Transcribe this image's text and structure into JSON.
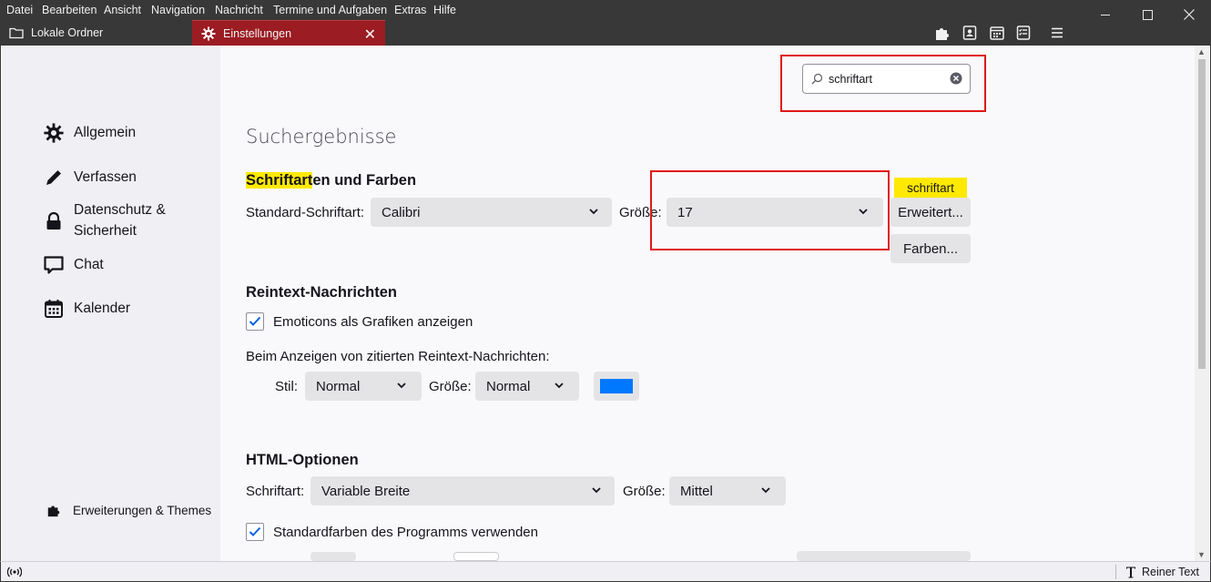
{
  "menubar": {
    "items": [
      "Datei",
      "Bearbeiten",
      "Ansicht",
      "Navigation",
      "Nachricht",
      "Termine und Aufgaben",
      "Extras",
      "Hilfe"
    ]
  },
  "tabs": [
    {
      "label": "Lokale Ordner",
      "icon": "folder-icon",
      "active": false
    },
    {
      "label": "Einstellungen",
      "icon": "gear-icon",
      "active": true
    }
  ],
  "toolbar_icons": [
    "addons-icon",
    "address-book-icon",
    "calendar-icon",
    "tasks-icon",
    "menu-icon"
  ],
  "sidebar": {
    "categories": [
      {
        "label": "Allgemein",
        "icon": "gear-icon"
      },
      {
        "label": "Verfassen",
        "icon": "pencil-icon"
      },
      {
        "label": "Datenschutz &\nSicherheit",
        "icon": "lock-icon"
      },
      {
        "label": "Chat",
        "icon": "chat-icon"
      },
      {
        "label": "Kalender",
        "icon": "calendar-icon"
      }
    ],
    "extensions_label": "Erweiterungen & Themes"
  },
  "search": {
    "value": "schriftart"
  },
  "heading": "Suchergebnisse",
  "fonts_section": {
    "title_highlight": "Schriftart",
    "title_rest": "en und Farben",
    "default_font_label": "Standard-Schriftart:",
    "default_font_value": "Calibri",
    "size_label": "Größe:",
    "size_value": "17",
    "advanced_button": "Erweitert...",
    "colors_button": "Farben...",
    "tooltip": "schriftart"
  },
  "plaintext_section": {
    "title": "Reintext-Nachrichten",
    "emoticons_label": "Emoticons als Grafiken anzeigen",
    "emoticons_checked": true,
    "quoted_label": "Beim Anzeigen von zitierten Reintext-Nachrichten:",
    "style_label": "Stil:",
    "style_value": "Normal",
    "size_label": "Größe:",
    "size_value": "Normal",
    "quote_color": "#0078ff"
  },
  "html_section": {
    "title": "HTML-Optionen",
    "font_label": "Schriftart:",
    "font_value": "Variable Breite",
    "size_label": "Größe:",
    "size_value": "Mittel",
    "default_colors_label": "Standardfarben des Programms verwenden",
    "default_colors_checked": true
  },
  "statusbar": {
    "plain_text": "Reiner Text"
  },
  "colors": {
    "accent": "#0060df",
    "highlight": "#ffe900",
    "annotation": "#e01818",
    "active_tab": "#9b1c22"
  }
}
